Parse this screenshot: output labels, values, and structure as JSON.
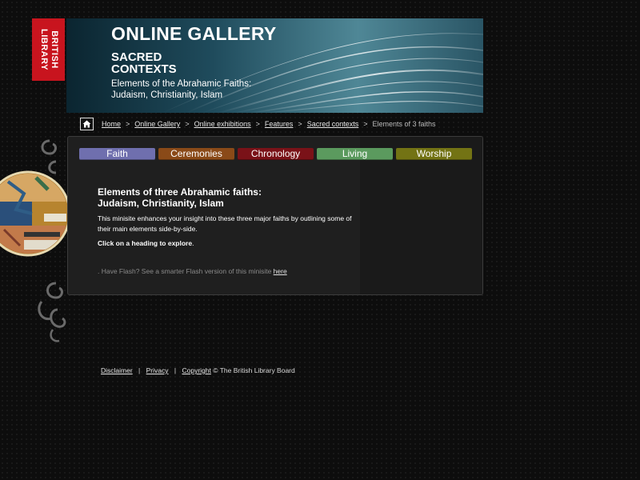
{
  "logo": {
    "line1": "BRITISH",
    "line2": "LIBRARY",
    "color": "#c8141e"
  },
  "banner": {
    "title": "ONLINE GALLERY",
    "subtitle_line1": "SACRED",
    "subtitle_line2": "CONTEXTS",
    "desc_line1": "Elements of the Abrahamic Faiths:",
    "desc_line2": "Judaism, Christianity, Islam"
  },
  "breadcrumb": {
    "items": [
      "Home",
      "Online Gallery",
      "Online exhibitions",
      "Features",
      "Sacred contexts"
    ],
    "current": "Elements of 3 faiths",
    "separator": ">"
  },
  "tabs": [
    {
      "label": "Faith",
      "color": "#6f6fae"
    },
    {
      "label": "Ceremonies",
      "color": "#8a4a18"
    },
    {
      "label": "Chronology",
      "color": "#7a1218"
    },
    {
      "label": "Living",
      "color": "#5b9a5e"
    },
    {
      "label": "Worship",
      "color": "#737314"
    }
  ],
  "content": {
    "heading_line1": "Elements of three Abrahamic faiths:",
    "heading_line2": "Judaism, Christianity, Islam",
    "intro": "This minisite enhances your insight into these three major faiths by outlining some of their main elements side-by-side.",
    "instruction": "Click on a heading to explore",
    "instruction_end": ".",
    "flash_prefix": ". Have Flash? See a smarter Flash version of this minisite ",
    "flash_link": "here"
  },
  "footer": {
    "disclaimer": "Disclaimer",
    "privacy": "Privacy",
    "copyright": "Copyright",
    "separator": "|",
    "owner": "© The British Library Board"
  }
}
